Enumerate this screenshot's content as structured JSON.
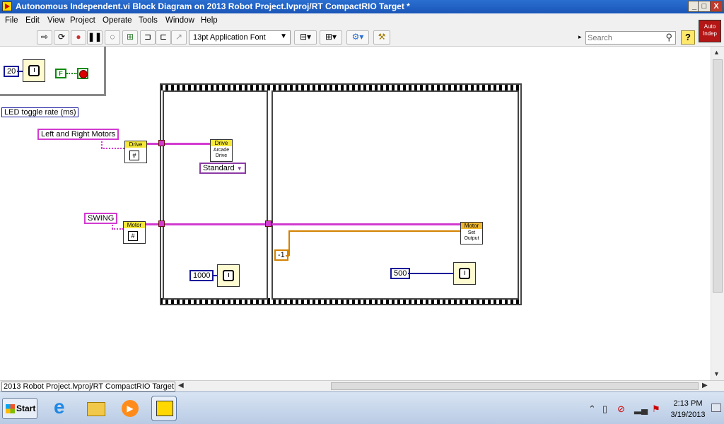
{
  "window": {
    "title": "Autonomous Independent.vi Block Diagram on 2013 Robot Project.lvproj/RT CompactRIO Target *",
    "controls": {
      "minimize": "_",
      "maximize": "□",
      "close": "X"
    }
  },
  "menu": [
    "File",
    "Edit",
    "View",
    "Project",
    "Operate",
    "Tools",
    "Window",
    "Help"
  ],
  "toolbar": {
    "font_dropdown": "13pt Application Font",
    "search_placeholder": "Search",
    "help": "?",
    "vi_icon_text": [
      "Auto",
      "Indep"
    ]
  },
  "diagram": {
    "prev_frame": {
      "wait_constant": "20",
      "bool_constant": "F"
    },
    "led_label": "LED toggle rate (ms)",
    "left_right_motors": "Left and Right Motors",
    "drive_ref_header": "Drive",
    "drive_ref_symbol": "#",
    "swing": "SWING",
    "motor_ref_header": "Motor",
    "motor_ref_symbol": "#",
    "arcade": {
      "header": "Drive",
      "line1": "Arcade",
      "line2": "Drive"
    },
    "arcade_mode": "Standard",
    "wait_1000": "1000",
    "neg_one": "-1",
    "set_output": {
      "header": "Motor",
      "line1": "Set",
      "line2": "Output"
    },
    "wait_500": "500"
  },
  "status": {
    "target": "2013 Robot Project.lvproj/RT CompactRIO Target"
  },
  "taskbar": {
    "start": "Start",
    "time": "2:13 PM",
    "date": "3/19/2013"
  },
  "colors": {
    "wire_pink": "#d23ad0",
    "wire_blue": "#16169a",
    "wire_orange": "#d38100"
  }
}
